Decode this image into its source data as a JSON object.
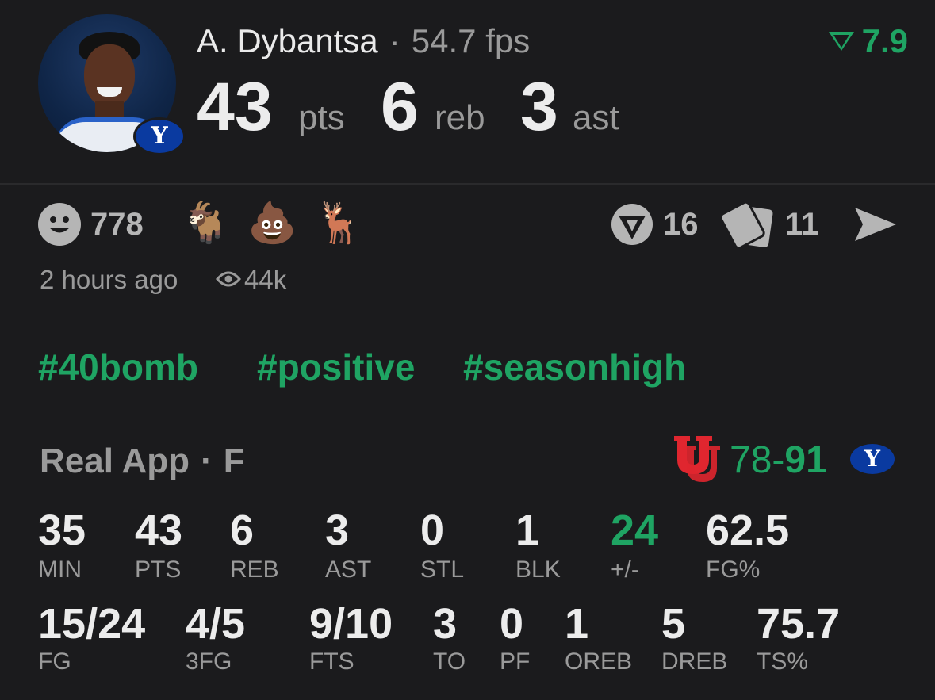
{
  "player": {
    "name": "A. Dybantsa",
    "separator": "·",
    "fps": "54.7 fps",
    "rating": "7.9",
    "team_logo": "Y",
    "stats": [
      {
        "value": "43",
        "unit": "pts"
      },
      {
        "value": "6",
        "unit": "reb"
      },
      {
        "value": "3",
        "unit": "ast"
      }
    ]
  },
  "reactions": {
    "smile_count": "778",
    "emojis": [
      "🐐",
      "💩",
      "🦌"
    ],
    "comments_count": "16",
    "cards_count": "11"
  },
  "meta": {
    "time": "2 hours ago",
    "views": "44k"
  },
  "tags": [
    "#40bomb",
    "#positive",
    "#seasonhigh"
  ],
  "game": {
    "source": "Real App",
    "separator": "·",
    "status": "F",
    "away_logo": "U",
    "home_logo": "Y",
    "away_score": "78",
    "dash": "-",
    "home_score": "91"
  },
  "box_row1": [
    {
      "value": "35",
      "label": "MIN"
    },
    {
      "value": "43",
      "label": "PTS"
    },
    {
      "value": "6",
      "label": "REB"
    },
    {
      "value": "3",
      "label": "AST"
    },
    {
      "value": "0",
      "label": "STL"
    },
    {
      "value": "1",
      "label": "BLK"
    },
    {
      "value": "24",
      "label": "+/-"
    },
    {
      "value": "62.5",
      "label": "FG%"
    }
  ],
  "box_row2": [
    {
      "value": "15/24",
      "label": "FG"
    },
    {
      "value": "4/5",
      "label": "3FG"
    },
    {
      "value": "9/10",
      "label": "FTS"
    },
    {
      "value": "3",
      "label": "TO"
    },
    {
      "value": "0",
      "label": "PF"
    },
    {
      "value": "1",
      "label": "OREB"
    },
    {
      "value": "5",
      "label": "DREB"
    },
    {
      "value": "75.7",
      "label": "TS%"
    }
  ],
  "colors": {
    "accent_green": "#1fa463",
    "utah_red": "#e0262f",
    "byu_blue": "#0a3aa0"
  }
}
